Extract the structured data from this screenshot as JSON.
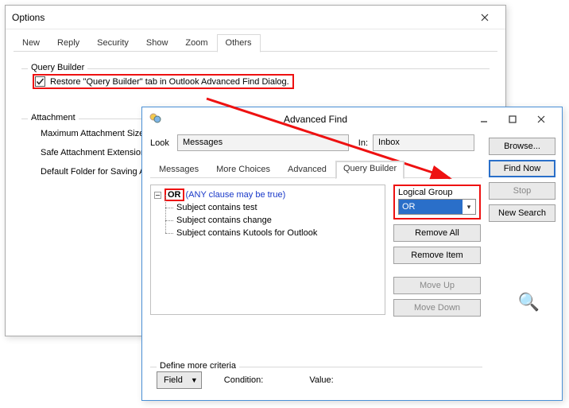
{
  "options_window": {
    "title": "Options",
    "tabs": [
      "New",
      "Reply",
      "Security",
      "Show",
      "Zoom",
      "Others"
    ],
    "active_tab": "Others",
    "query_builder_group": "Query Builder",
    "restore_checkbox": "Restore \"Query Builder\" tab in Outlook Advanced Find Dialog.",
    "attachment_group": "Attachment",
    "attachment_opts": [
      "Maximum Attachment Size",
      "Safe Attachment Extension",
      "Default Folder for Saving A"
    ]
  },
  "advanced_find": {
    "title": "Advanced Find",
    "look_label": "Look",
    "look_value": "Messages",
    "in_label": "In:",
    "in_value": "Inbox",
    "browse": "Browse...",
    "find_now": "Find Now",
    "stop": "Stop",
    "new_search": "New Search",
    "tabs": [
      "Messages",
      "More Choices",
      "Advanced",
      "Query Builder"
    ],
    "active_tab": "Query Builder",
    "tree": {
      "root_op": "OR",
      "root_note": "(ANY clause may be true)",
      "children": [
        "Subject contains test",
        "Subject contains change",
        "Subject contains Kutools for Outlook"
      ]
    },
    "logical_group": {
      "label": "Logical Group",
      "value": "OR"
    },
    "remove_all": "Remove All",
    "remove_item": "Remove Item",
    "move_up": "Move Up",
    "move_down": "Move Down",
    "define_more": "Define more criteria",
    "field_btn": "Field",
    "condition_label": "Condition:",
    "value_label": "Value:"
  }
}
